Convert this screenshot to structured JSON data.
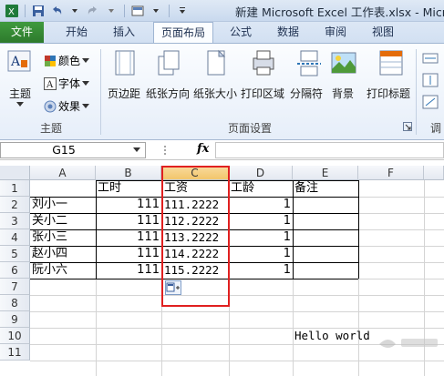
{
  "titlebar": {
    "title": "新建 Microsoft Excel 工作表.xlsx - Micro"
  },
  "tabs": [
    "文件",
    "开始",
    "插入",
    "页面布局",
    "公式",
    "数据",
    "审阅",
    "视图"
  ],
  "ribbon": {
    "theme_group": {
      "themes": "主题",
      "colors": "颜色",
      "fonts": "字体",
      "effects": "效果",
      "label": "主题"
    },
    "page_setup": {
      "margins": "页边距",
      "orientation": "纸张方向",
      "size": "纸张大小",
      "print_area": "打印区域",
      "breaks": "分隔符",
      "background": "背景",
      "print_titles": "打印标题",
      "label": "页面设置"
    },
    "right_cut": "调"
  },
  "formula_bar": {
    "name_box": "G15",
    "fx": "fx"
  },
  "columns": [
    "A",
    "B",
    "C",
    "D",
    "E",
    "F"
  ],
  "rows": [
    "1",
    "2",
    "3",
    "4",
    "5",
    "6",
    "7",
    "8",
    "9",
    "10",
    "11"
  ],
  "table": {
    "header": {
      "B": "工时",
      "C": "工资",
      "D": "工龄",
      "E": "备注"
    },
    "records": [
      {
        "name": "刘小一",
        "hours": "111",
        "wage": "111.2222",
        "years": "1"
      },
      {
        "name": "关小二",
        "hours": "111",
        "wage": "112.2222",
        "years": "1"
      },
      {
        "name": "张小三",
        "hours": "111",
        "wage": "113.2222",
        "years": "1"
      },
      {
        "name": "赵小四",
        "hours": "111",
        "wage": "114.2222",
        "years": "1"
      },
      {
        "name": "阮小六",
        "hours": "111",
        "wage": "115.2222",
        "years": "1"
      }
    ]
  },
  "extra_cell": "Hello world",
  "colors": {
    "file_tab": "#2d7a2c",
    "highlight": "#e02020",
    "ribbon": "#e6eef9"
  }
}
